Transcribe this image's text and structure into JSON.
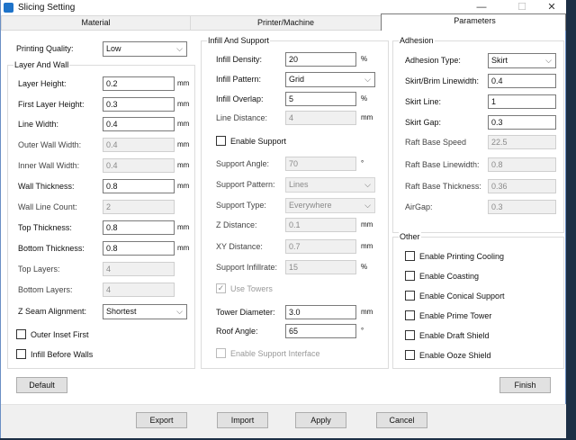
{
  "window": {
    "title": "Slicing Setting",
    "minimize": "—",
    "maximize": "☐",
    "close": "✕"
  },
  "tabs": [
    {
      "label": "Material"
    },
    {
      "label": "Printer/Machine"
    },
    {
      "label": "Parameters",
      "selected": true
    }
  ],
  "printing_quality": {
    "label": "Printing Quality:",
    "value": "Low"
  },
  "layer_and_wall": {
    "title": "Layer And Wall",
    "rows": [
      {
        "label": "Layer Height:",
        "value": "0.2",
        "unit": "mm",
        "enabled": true
      },
      {
        "label": "First Layer Height:",
        "value": "0.3",
        "unit": "mm",
        "enabled": true
      },
      {
        "label": "Line Width:",
        "value": "0.4",
        "unit": "mm",
        "enabled": true
      },
      {
        "label": "Outer Wall Width:",
        "value": "0.4",
        "unit": "mm",
        "enabled": false
      },
      {
        "label": "Inner Wall Width:",
        "value": "0.4",
        "unit": "mm",
        "enabled": false
      },
      {
        "label": "Wall Thickness:",
        "value": "0.8",
        "unit": "mm",
        "enabled": true
      },
      {
        "label": "Wall Line Count:",
        "value": "2",
        "unit": "",
        "enabled": false
      },
      {
        "label": "Top Thickness:",
        "value": "0.8",
        "unit": "mm",
        "enabled": true
      },
      {
        "label": "Bottom Thickness:",
        "value": "0.8",
        "unit": "mm",
        "enabled": true
      },
      {
        "label": "Top Layers:",
        "value": "4",
        "unit": "",
        "enabled": false
      },
      {
        "label": "Bottom Layers:",
        "value": "4",
        "unit": "",
        "enabled": false
      },
      {
        "label": "Z Seam Alignment:",
        "value": "Shortest",
        "unit": "",
        "enabled": true,
        "select": true
      }
    ],
    "checkboxes": [
      {
        "label": "Outer Inset First",
        "checked": false,
        "enabled": true
      },
      {
        "label": "Infill Before Walls",
        "checked": false,
        "enabled": true
      }
    ]
  },
  "infill_support": {
    "title": "Infill And Support",
    "rows": [
      {
        "label": "Infill Density:",
        "value": "20",
        "unit": "%",
        "enabled": true
      },
      {
        "label": "Infill Pattern:",
        "value": "Grid",
        "unit": "",
        "enabled": true,
        "select": true
      },
      {
        "label": "Infill Overlap:",
        "value": "5",
        "unit": "%",
        "enabled": true
      },
      {
        "label": "Line Distance:",
        "value": "4",
        "unit": "mm",
        "enabled": false
      },
      {
        "checkbox": true,
        "label": "Enable Support",
        "checked": false,
        "enabled": true
      },
      {
        "label": "Support Angle:",
        "value": "70",
        "unit": "°",
        "enabled": false
      },
      {
        "label": "Support Pattern:",
        "value": "Lines",
        "unit": "",
        "enabled": false,
        "select": true
      },
      {
        "label": "Support Type:",
        "value": "Everywhere",
        "unit": "",
        "enabled": false,
        "select": true
      },
      {
        "label": "Z Distance:",
        "value": "0.1",
        "unit": "mm",
        "enabled": false
      },
      {
        "label": "XY Distance:",
        "value": "0.7",
        "unit": "mm",
        "enabled": false
      },
      {
        "label": "Support Infillrate:",
        "value": "15",
        "unit": "%",
        "enabled": false
      },
      {
        "checkbox": true,
        "label": "Use Towers",
        "checked": true,
        "enabled": false
      },
      {
        "label": "Tower Diameter:",
        "value": "3.0",
        "unit": "mm",
        "enabled": true
      },
      {
        "label": "Roof Angle:",
        "value": "65",
        "unit": "°",
        "enabled": true
      },
      {
        "checkbox": true,
        "label": "Enable Support Interface",
        "checked": false,
        "enabled": false
      }
    ]
  },
  "adhesion": {
    "title": "Adhesion",
    "rows": [
      {
        "label": "Adhesion Type:",
        "value": "Skirt",
        "enabled": true,
        "select": true
      },
      {
        "label": "Skirt/Brim Linewidth:",
        "value": "0.4",
        "enabled": true
      },
      {
        "label": "Skirt Line:",
        "value": "1",
        "enabled": true
      },
      {
        "label": "Skirt Gap:",
        "value": "0.3",
        "enabled": true
      },
      {
        "label": "Raft Base Speed",
        "value": "22.5",
        "enabled": false
      },
      {
        "label": "Raft Base Linewidth:",
        "value": "0.8",
        "enabled": false
      },
      {
        "label": "Raft Base Thickness:",
        "value": "0.36",
        "enabled": false
      },
      {
        "label": "AirGap:",
        "value": "0.3",
        "enabled": false
      }
    ]
  },
  "other": {
    "title": "Other",
    "checkboxes": [
      {
        "label": "Enable Printing Cooling",
        "checked": false
      },
      {
        "label": "Enable Coasting",
        "checked": false
      },
      {
        "label": "Enable Conical Support",
        "checked": false
      },
      {
        "label": "Enable Prime Tower",
        "checked": false
      },
      {
        "label": "Enable Draft Shield",
        "checked": false
      },
      {
        "label": "Enable Ooze Shield",
        "checked": false
      }
    ]
  },
  "buttons": {
    "default": "Default",
    "finish": "Finish",
    "export": "Export",
    "import": "Import",
    "apply": "Apply",
    "cancel": "Cancel"
  }
}
